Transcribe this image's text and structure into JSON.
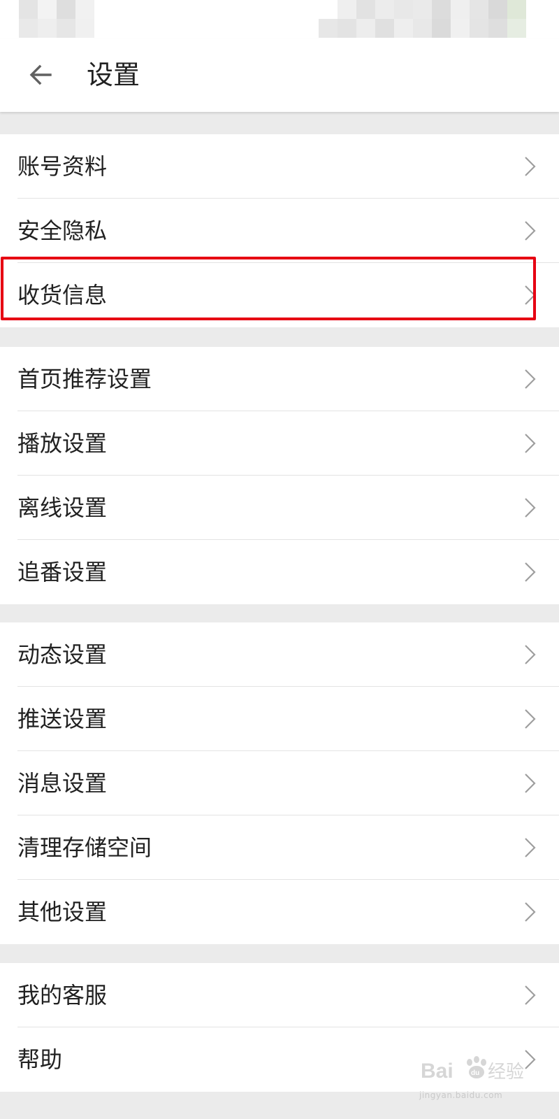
{
  "header": {
    "title": "设置",
    "back_icon": "arrow-left-icon"
  },
  "groups": [
    {
      "items": [
        {
          "name": "account-profile",
          "label": "账号资料"
        },
        {
          "name": "security-privacy",
          "label": "安全隐私"
        },
        {
          "name": "shipping-info",
          "label": "收货信息"
        }
      ]
    },
    {
      "items": [
        {
          "name": "home-recommend-settings",
          "label": "首页推荐设置"
        },
        {
          "name": "playback-settings",
          "label": "播放设置"
        },
        {
          "name": "offline-settings",
          "label": "离线设置"
        },
        {
          "name": "follow-settings",
          "label": "追番设置"
        }
      ]
    },
    {
      "items": [
        {
          "name": "feed-settings",
          "label": "动态设置"
        },
        {
          "name": "push-settings",
          "label": "推送设置"
        },
        {
          "name": "message-settings",
          "label": "消息设置"
        },
        {
          "name": "clear-storage",
          "label": "清理存储空间"
        },
        {
          "name": "other-settings",
          "label": "其他设置"
        }
      ]
    },
    {
      "items": [
        {
          "name": "my-customer-service",
          "label": "我的客服"
        },
        {
          "name": "help",
          "label": "帮助"
        }
      ]
    }
  ],
  "highlighted_item": "收货信息",
  "watermark": {
    "brand": "Bai du 经验",
    "url": "jingyan.baidu.com"
  },
  "colors": {
    "highlight": "#e60012",
    "chevron": "#9e9e9e",
    "text": "#212121",
    "group_gap": "#ebebeb"
  }
}
